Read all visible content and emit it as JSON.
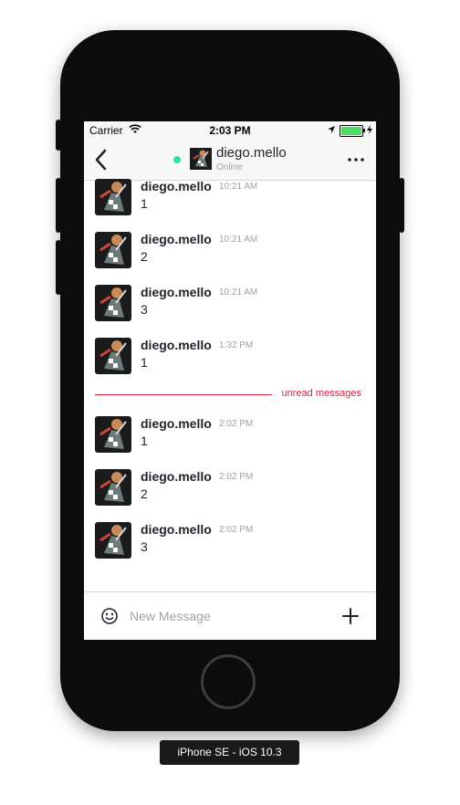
{
  "statusbar": {
    "carrier": "Carrier",
    "time": "2:03 PM",
    "battery_percent": 100
  },
  "header": {
    "title": "diego.mello",
    "status": "Online",
    "status_color": "#2de0a5"
  },
  "messages": [
    {
      "user": "diego.mello",
      "time": "10:21 AM",
      "text": "1"
    },
    {
      "user": "diego.mello",
      "time": "10:21 AM",
      "text": "2"
    },
    {
      "user": "diego.mello",
      "time": "10:21 AM",
      "text": "3"
    },
    {
      "user": "diego.mello",
      "time": "1:32 PM",
      "text": "1"
    },
    {
      "user": "diego.mello",
      "time": "2:02 PM",
      "text": "1"
    },
    {
      "user": "diego.mello",
      "time": "2:02 PM",
      "text": "2"
    },
    {
      "user": "diego.mello",
      "time": "2:02 PM",
      "text": "3"
    }
  ],
  "unread_separator": {
    "label": "unread messages",
    "color": "#e01e3c"
  },
  "composer": {
    "placeholder": "New Message"
  },
  "device_label": "iPhone SE - iOS 10.3",
  "colors": {
    "accent_red": "#e01e3c",
    "online_green": "#2de0a5",
    "battery_green": "#4cd964"
  }
}
